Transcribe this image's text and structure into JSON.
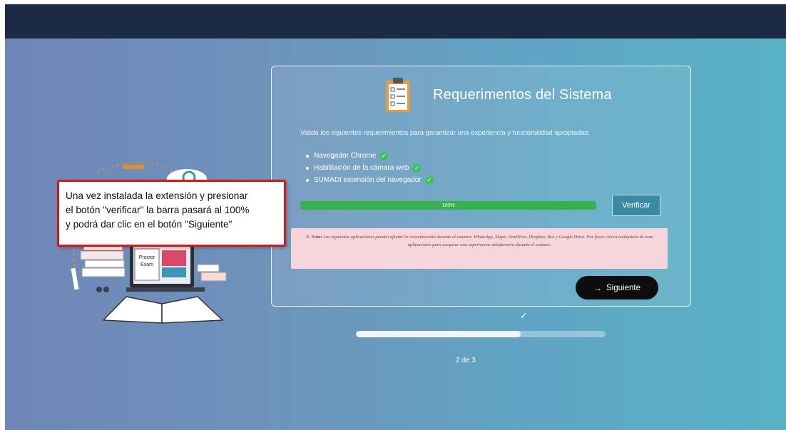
{
  "card": {
    "title": "Requerimentos del Sistema",
    "description": "Valida los siguientes requerimientos para garantizar una experiencia y funcionalidad apropiadas:",
    "requirements": [
      {
        "label": "Navegador Chrome",
        "status": "ok"
      },
      {
        "label": "Habilitación de la cámara web",
        "status": "ok"
      },
      {
        "label": "SUMADI extensión del navegador",
        "status": "ok"
      }
    ],
    "progress": {
      "value_percent": 100,
      "label": "100%"
    },
    "verify_label": "Verificar",
    "note": {
      "prefix": "Nota:",
      "text": "Las siguientes aplicaciones pueden afectar la concentración durante el examen: WhatsApp, Skype, OneDrive, Dropbox, Box y Google Drive. Por favor cierra cualquiera de esas aplicaciones para asegurar una experiencia satisfactoria durante el examen."
    },
    "next_label": "Siguiente"
  },
  "steps": {
    "current": 2,
    "total": 3,
    "label": "2 de 3",
    "progress_fraction": 0.66
  },
  "callout": {
    "line1": "Una vez instalada la extensión y presionar",
    "line2": "el botón \"verificar\" la barra pasará al 100%",
    "line3": "y podrá dar clic en el botón \"Siguiente\""
  },
  "illustration": {
    "book_label_1": "Proctor",
    "book_label_2": "Exam"
  },
  "colors": {
    "topbar": "#1b2a45",
    "progress": "#34b04c",
    "check": "#3cc361",
    "note_bg": "#f6d5db",
    "callout_border": "#d21818",
    "verify_bg": "#3a8aa2"
  },
  "icons": [
    "clipboard-icon",
    "check-circle-icon",
    "warning-icon",
    "arrow-right-icon",
    "checkmark-icon"
  ]
}
